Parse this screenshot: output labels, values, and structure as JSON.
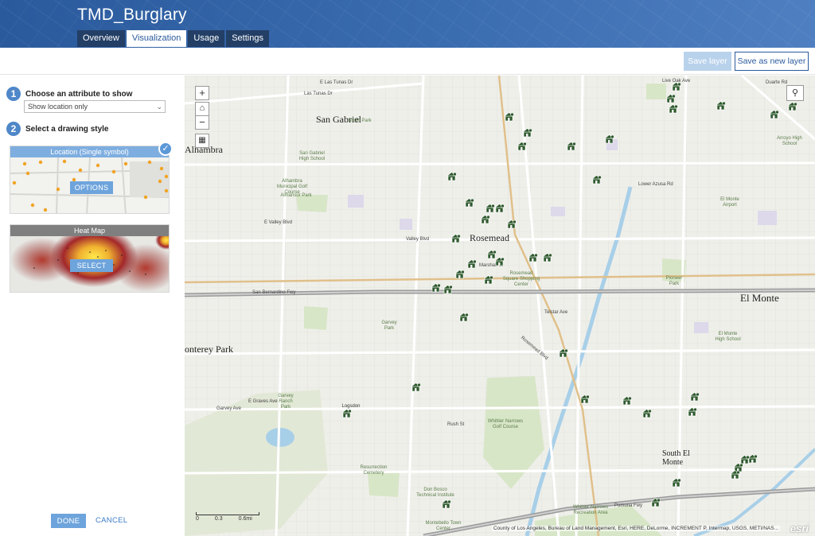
{
  "header": {
    "title": "TMD_Burglary",
    "tabs": [
      {
        "label": "Overview",
        "active": false
      },
      {
        "label": "Visualization",
        "active": true
      },
      {
        "label": "Usage",
        "active": false
      },
      {
        "label": "Settings",
        "active": false
      }
    ]
  },
  "toolbar": {
    "save_label": "Save layer",
    "save_new_label": "Save as new layer"
  },
  "panel": {
    "step1": {
      "number": "1",
      "label": "Choose an attribute to show",
      "select_value": "Show location only"
    },
    "step2": {
      "number": "2",
      "label": "Select a drawing style"
    },
    "styles": [
      {
        "title": "Location (Single symbol)",
        "button": "OPTIONS",
        "selected": true
      },
      {
        "title": "Heat Map",
        "button": "SELECT",
        "selected": false
      }
    ],
    "done_label": "DONE",
    "cancel_label": "CANCEL"
  },
  "map": {
    "places": [
      "San Gabriel",
      "Alhambra",
      "Rosemead",
      "El Monte",
      "South El Monte",
      "onterey Park"
    ],
    "poi": [
      "San Gabriel High School",
      "Alhambra Municipal Golf Course",
      "Almansor Park",
      "Smith Park",
      "Garvey Park",
      "Garvey Ranch Park",
      "Whittier Narrows Golf Course",
      "Resurrection Cemetery",
      "Don Bosco Technical Institute",
      "Rosemead Square Shopping Center",
      "Arroyo High School",
      "El Monte Airport",
      "Pioneer Park",
      "El Monte High School",
      "Whittier Narrows Recreation Area",
      "Montebello Town Center",
      "Logsdon"
    ],
    "roads": [
      "Las Tunas Dr",
      "San Bernardino Fwy",
      "Pomona Fwy",
      "Rosemead Blvd",
      "Valley Blvd",
      "Garvey Ave",
      "Marshall St",
      "Telstar Ave",
      "E Graves Ave",
      "Rush St",
      "Lower Azusa Rd",
      "E Valley Blvd",
      "Live Oak Ave",
      "Duarte Rd",
      "E Las Tunas Dr"
    ],
    "scale_labels": [
      "0",
      "0.3",
      "0.6mi"
    ],
    "attribution": "County of Los Angeles, Bureau of Land Management, Esri, HERE, DeLorme, INCREMENT P, Intermap, USGS, METI/NAS...",
    "esri": "esri",
    "marker_color": "#2f5a2e"
  }
}
